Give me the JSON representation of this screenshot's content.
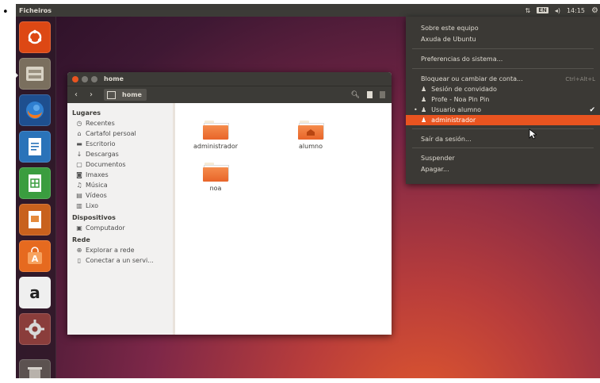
{
  "panel": {
    "app_name": "Ficheiros",
    "clock": "14:15"
  },
  "launcher": {
    "items": [
      {
        "name": "dash-home",
        "color": "#dd4814"
      },
      {
        "name": "files",
        "color": "#7a6f5e"
      },
      {
        "name": "firefox",
        "color": "#1e6fb5"
      },
      {
        "name": "libreoffice-writer",
        "color": "#2a73b9"
      },
      {
        "name": "libreoffice-calc",
        "color": "#3a9d3f"
      },
      {
        "name": "libreoffice-impress",
        "color": "#c8611d"
      },
      {
        "name": "software-center",
        "color": "#e66a1f"
      },
      {
        "name": "amazon",
        "color": "#e9e9e9"
      },
      {
        "name": "system-settings",
        "color": "#8a3d3b"
      },
      {
        "name": "trash",
        "color": "#5c5250"
      }
    ]
  },
  "file_manager": {
    "title": "home",
    "breadcrumb": "home",
    "sidebar": {
      "places_heading": "Lugares",
      "places": [
        "Recentes",
        "Cartafol persoal",
        "Escritorio",
        "Descargas",
        "Documentos",
        "Imaxes",
        "Música",
        "Vídeos",
        "Lixo"
      ],
      "devices_heading": "Dispositivos",
      "devices": [
        "Computador"
      ],
      "network_heading": "Rede",
      "network": [
        "Explorar a rede",
        "Conectar a un servi..."
      ]
    },
    "files": [
      {
        "label": "administrador"
      },
      {
        "label": "alumno"
      },
      {
        "label": "noa"
      }
    ]
  },
  "session_menu": {
    "about": "Sobre este equipo",
    "help": "Axuda de Ubuntu",
    "prefs": "Preferencias do sistema...",
    "lock": "Bloquear ou cambiar de conta...",
    "lock_shortcut": "Ctrl+Alt+L",
    "guest": "Sesión de convidado",
    "user_noa": "Profe - Noa Pin Pin",
    "user_alumno": "Usuario alumno",
    "user_admin": "administrador",
    "logout": "Saír da sesión...",
    "suspend": "Suspender",
    "shutdown": "Apagar..."
  }
}
